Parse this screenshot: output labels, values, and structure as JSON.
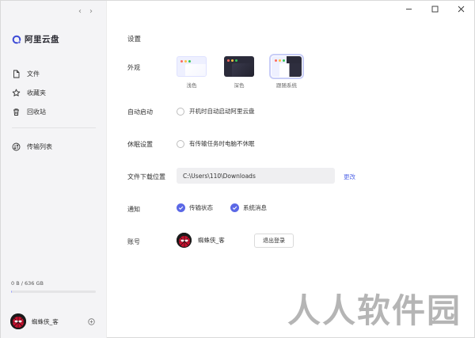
{
  "sidebar": {
    "brand": "阿里云盘",
    "items": [
      {
        "label": "文件",
        "icon": "file-icon"
      },
      {
        "label": "收藏夹",
        "icon": "star-icon"
      },
      {
        "label": "回收站",
        "icon": "trash-icon"
      }
    ],
    "transfer": {
      "label": "传输列表",
      "icon": "transfer-icon"
    },
    "storage": {
      "text": "0 B / 636 GB",
      "used_fraction": 0.005
    },
    "user": {
      "name": "蜘蛛侠_客"
    }
  },
  "settings": {
    "title": "设置",
    "appearance": {
      "label": "外观",
      "options": [
        {
          "label": "浅色"
        },
        {
          "label": "深色"
        },
        {
          "label": "跟随系统",
          "selected": true
        }
      ]
    },
    "autostart": {
      "label": "自动启动",
      "option": "开机时自动启动阿里云盘",
      "checked": false
    },
    "sleep": {
      "label": "休眠设置",
      "option": "有传输任务时电脑不休眠",
      "checked": false
    },
    "download": {
      "label": "文件下载位置",
      "path": "C:\\Users\\110\\Downloads",
      "change": "更改"
    },
    "notify": {
      "label": "通知",
      "options": [
        {
          "label": "传输状态",
          "checked": true
        },
        {
          "label": "系统消息",
          "checked": true
        }
      ]
    },
    "account": {
      "label": "账号",
      "name": "蜘蛛侠_客",
      "logout": "退出登录"
    }
  },
  "watermark": "人人软件园",
  "colors": {
    "accent": "#5b68e6",
    "sidebar_bg": "#f4f4f6",
    "link": "#5b6ee8"
  }
}
